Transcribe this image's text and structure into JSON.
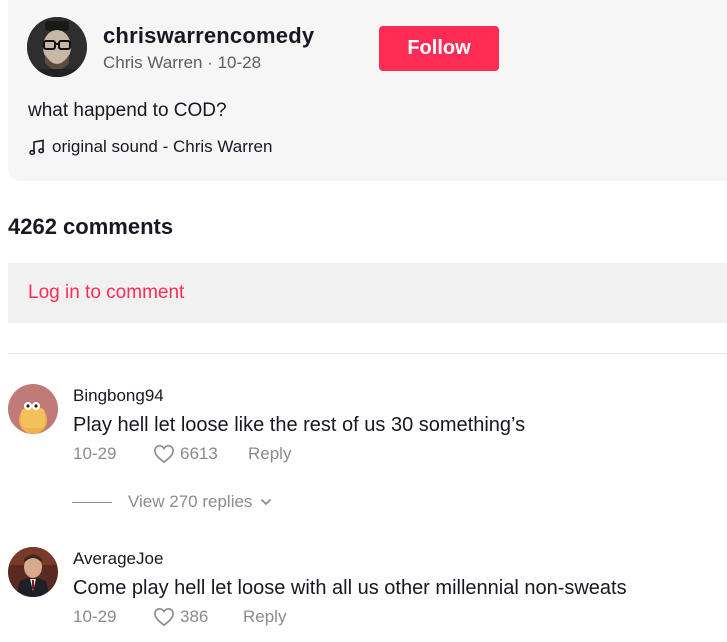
{
  "post": {
    "username": "chriswarrencomedy",
    "display_name": "Chris Warren",
    "date": "10-28",
    "subline": "Chris Warren · 10-28",
    "follow_label": "Follow",
    "caption": "what happend to COD?",
    "sound": "original sound - Chris Warren"
  },
  "comments_header": {
    "count_label": "4262 comments"
  },
  "login_prompt": "Log in to comment",
  "comments": [
    {
      "user": "Bingbong94",
      "text": "Play hell let loose like the rest of us 30 something’s",
      "date": "10-29",
      "likes": "6613",
      "reply_label": "Reply",
      "replies_label": "View 270 replies"
    },
    {
      "user": "AverageJoe",
      "text": "Come play hell let loose with all us other millennial non-sweats",
      "date": "10-29",
      "likes": "386",
      "reply_label": "Reply"
    }
  ],
  "colors": {
    "accent": "#fe2c55",
    "muted": "#8a8b91",
    "card_bg": "#f6f6f6"
  },
  "icons": [
    "music-note-icon",
    "heart-icon",
    "chevron-down-icon"
  ]
}
